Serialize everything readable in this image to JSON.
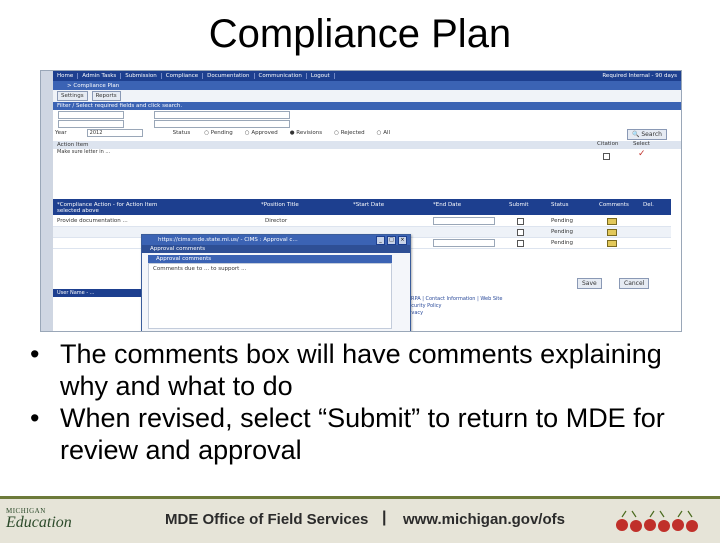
{
  "slide": {
    "title": "Compliance Plan",
    "bullets": [
      "The comments box will have comments explaining why and what to do",
      "When revised, select “Submit” to return to MDE for review and approval"
    ]
  },
  "app": {
    "nav_tabs": [
      "Home",
      "Admin Tasks",
      "Submission",
      "Compliance",
      "Documentation",
      "Communication",
      "Logout"
    ],
    "nav_right": "Required          Internal - 90 days",
    "breadcrumb": "> Compliance Plan",
    "toolbar": {
      "settings": "Settings",
      "reports": "Reports"
    },
    "filter": {
      "header": "Filter / Select required fields and click search.",
      "year_label": "Year",
      "year_value": "2012",
      "status_label": "Status",
      "status_options": [
        "Pending",
        "Approved",
        "Revisions",
        "Rejected",
        "All"
      ],
      "search_button": "Search"
    },
    "action_items": {
      "header": "Action Item",
      "row_text": "Make sure letter in ...",
      "col_citation": "Citation",
      "col_select": "Select"
    },
    "compliance_table": {
      "headers": [
        "*Compliance Action - for Action Item selected above",
        "*Position Title",
        "*Start Date",
        "*End Date",
        "Submit",
        "Status",
        "Comments",
        "Del."
      ],
      "rows": [
        {
          "action": "Provide documentation ...",
          "position": "Director",
          "start": "",
          "end": "",
          "status": "Pending"
        },
        {
          "action": "",
          "position": "",
          "start": "",
          "end": "",
          "status": "Pending"
        },
        {
          "action": "",
          "position": "",
          "start": "",
          "end": "",
          "status": "Pending"
        }
      ]
    },
    "buttons": {
      "save": "Save",
      "cancel": "Cancel"
    },
    "status_bar": "User Name - ...",
    "footer_links": [
      "FERPA | Contact Information | Web Site",
      "Security Policy",
      "Privacy"
    ],
    "popup": {
      "title": "https://cims.mde.state.mi.us/ - CIMS : Approval c...",
      "subtitle": "Approval comments",
      "label": "Approval comments",
      "text": "Comments due to ... to support ..."
    }
  },
  "footer": {
    "logo_line1": "MICHIGAN",
    "logo_line2": "Education",
    "office": "MDE Office of Field Services",
    "separator": "|",
    "url": "www.michigan.gov/ofs"
  },
  "colors": {
    "nav_blue": "#1d3f8f",
    "header_blue": "#3b63b4",
    "footer_bg": "#e6e4d8",
    "cherry_red": "#c0302a"
  }
}
